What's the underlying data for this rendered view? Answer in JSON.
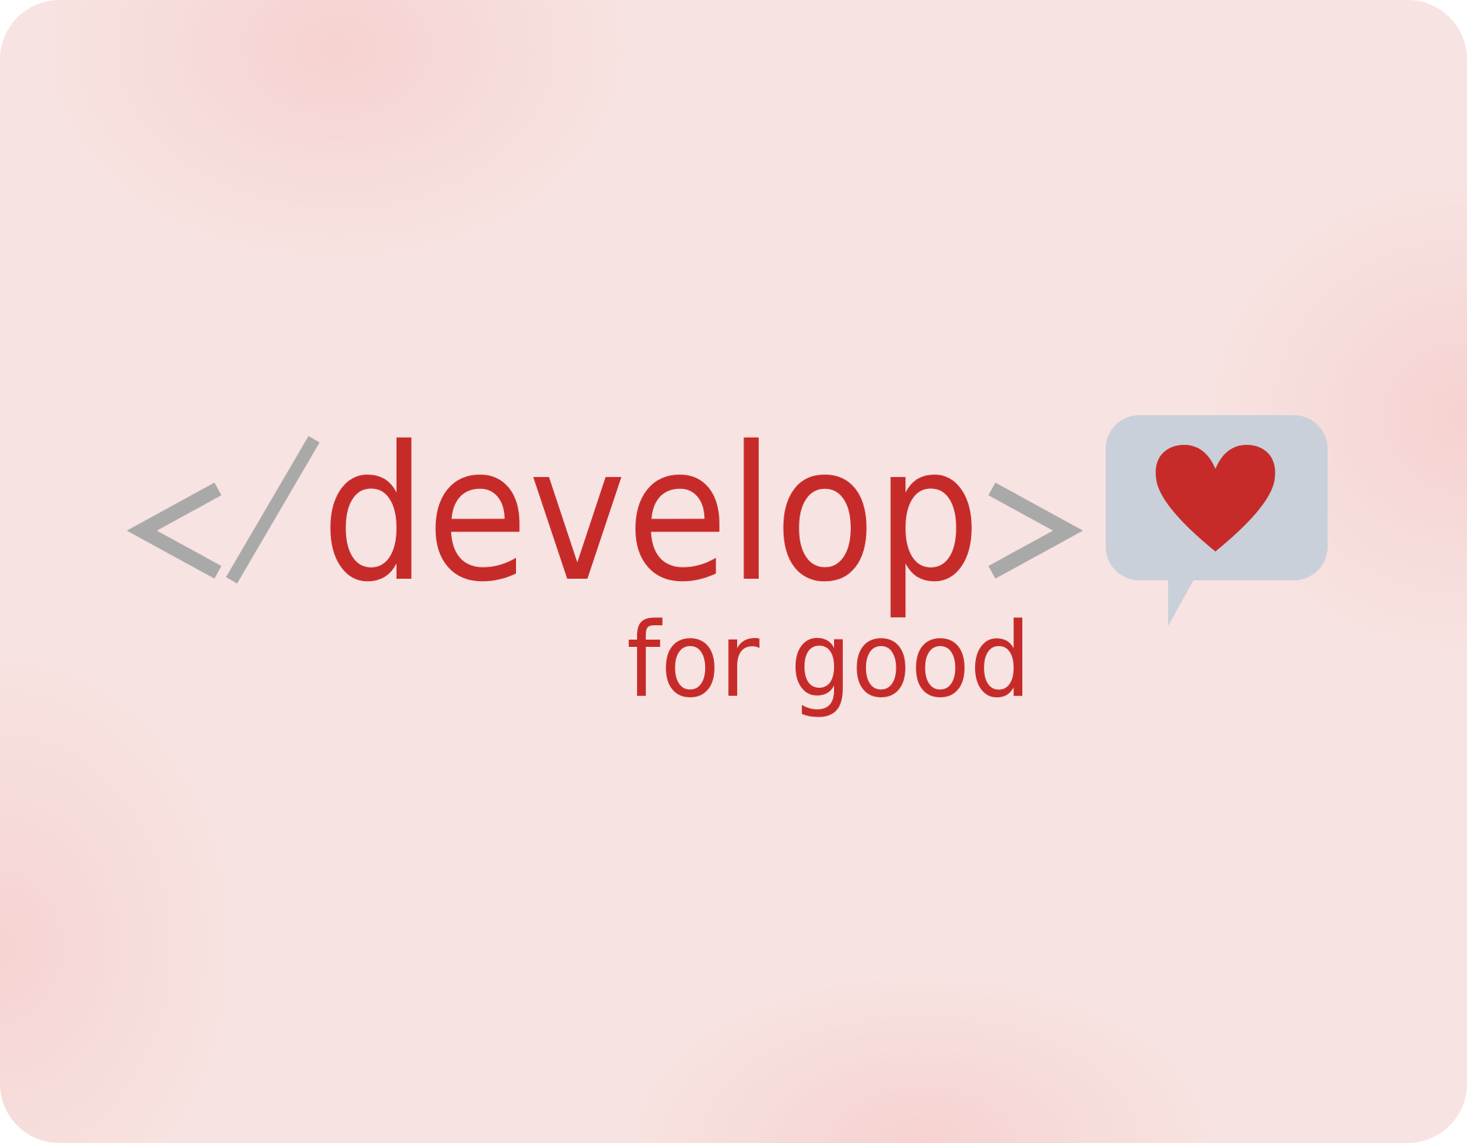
{
  "logo": {
    "word": "develop",
    "tagline": "for good"
  },
  "colors": {
    "brand_red": "#c62b29",
    "bracket_gray": "#a9a9a9",
    "bubble_blue_gray": "#c9d0da",
    "background": "#f7e3e1"
  },
  "icons": [
    "code-bracket-open-icon",
    "slash-icon",
    "code-bracket-close-icon",
    "speech-bubble-icon",
    "heart-icon"
  ]
}
